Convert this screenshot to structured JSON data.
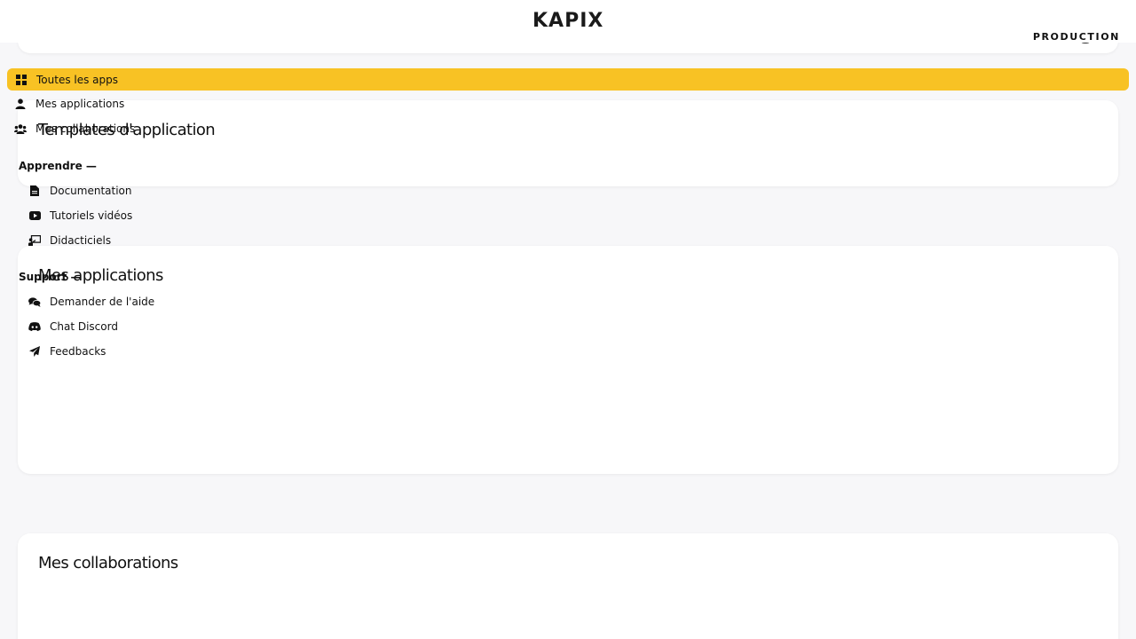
{
  "header": {
    "logo_text": "KAPIX",
    "env_label": "PRODUCTION"
  },
  "nav": {
    "all_apps": "Toutes les apps",
    "my_apps": "Mes applications",
    "my_collabs": "Mes collaborations"
  },
  "learn": {
    "heading": "Apprendre —",
    "items": [
      "Documentation",
      "Tutoriels vidéos",
      "Didacticiels"
    ]
  },
  "support": {
    "heading": "Support —",
    "items": [
      "Demander de l'aide",
      "Chat Discord",
      "Feedbacks"
    ]
  },
  "sections": {
    "templates_title": "Templates d'application",
    "my_apps_title": "Mes applications",
    "my_collabs_title": "Mes collaborations"
  },
  "colors": {
    "accent": "#f8c224",
    "background": "#f7f7f9",
    "card": "#ffffff"
  }
}
